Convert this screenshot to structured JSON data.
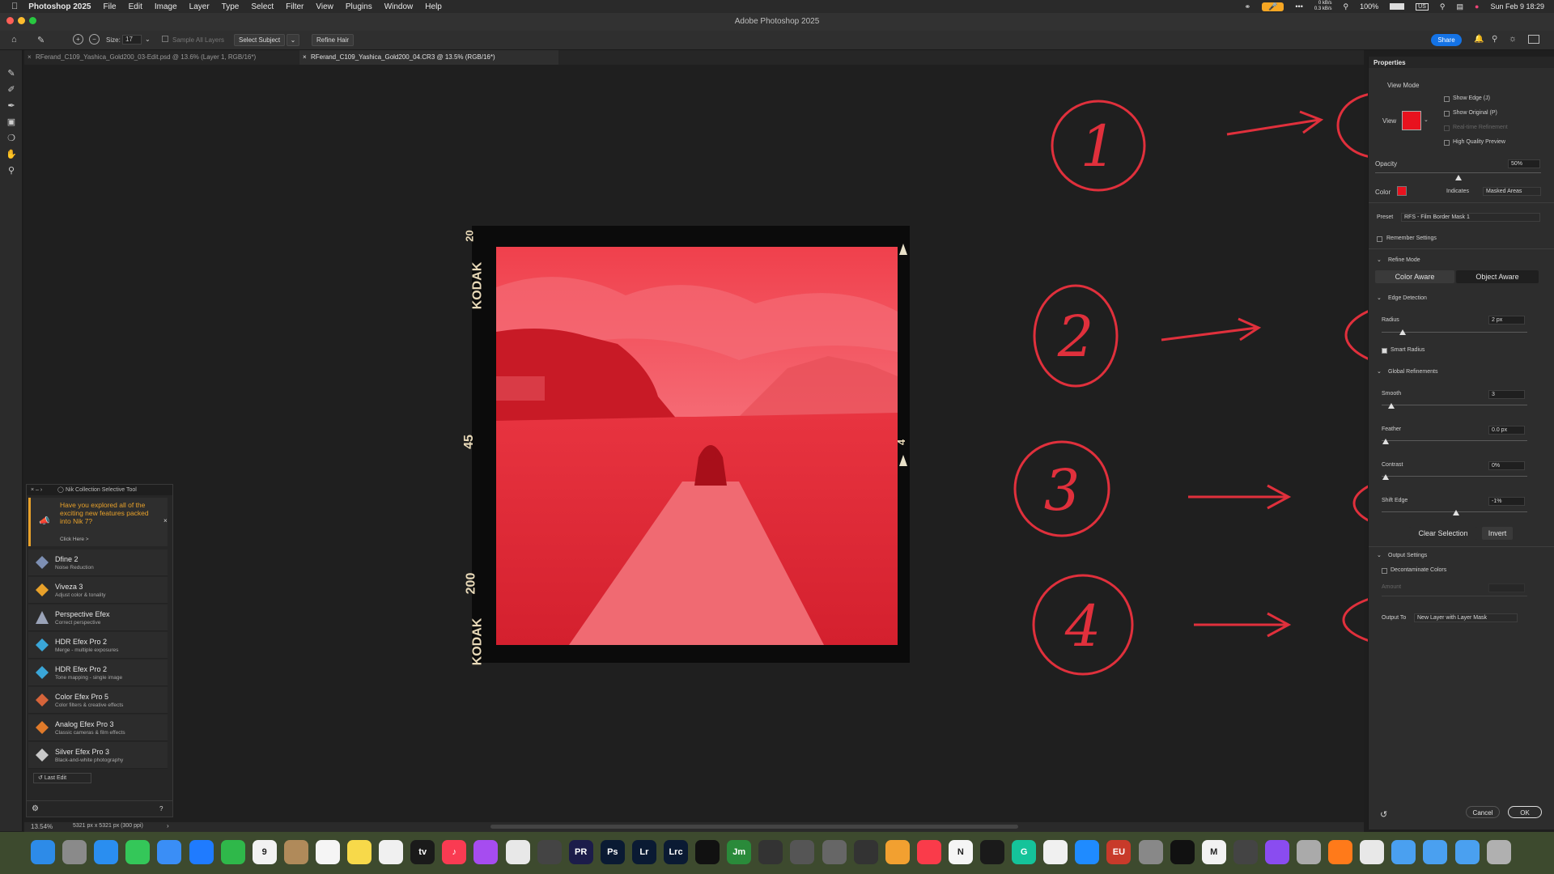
{
  "menubar": {
    "app_name": "Photoshop 2025",
    "items": [
      "File",
      "Edit",
      "Image",
      "Layer",
      "Type",
      "Select",
      "Filter",
      "View",
      "Plugins",
      "Window",
      "Help"
    ],
    "net_up": "0 kB/s",
    "net_down": "0.3 kB/s",
    "battery": "100%",
    "input_source": "US",
    "datetime": "Sun Feb 9  18:29"
  },
  "window": {
    "title": "Adobe Photoshop 2025"
  },
  "options_bar": {
    "size_label": "Size:",
    "size_value": "17",
    "sample_all_layers": "Sample All Layers",
    "select_subject": "Select Subject",
    "refine_hair": "Refine Hair",
    "share": "Share"
  },
  "tabs": [
    {
      "label": "RFerand_C109_Yashica_Gold200_03-Edit.psd @ 13.6% (Layer 1, RGB/16*)"
    },
    {
      "label": "RFerand_C109_Yashica_Gold200_04.CR3 @ 13.5% (RGB/16*)"
    }
  ],
  "film_border": {
    "top_number": "20",
    "brand_top": "KODAK",
    "middle_number": "45",
    "bottom_number": "200",
    "brand_bottom": "KODAK",
    "right_number": "4"
  },
  "annotations": {
    "numbers": [
      "1",
      "2",
      "3",
      "4"
    ],
    "color": "#e0303c"
  },
  "properties": {
    "header": "Properties",
    "view_mode": "View Mode",
    "view": "View",
    "show_edge": "Show Edge (J)",
    "show_original": "Show Original (P)",
    "realtime_refinement": "Real-time Refinement",
    "high_quality_preview": "High Quality Preview",
    "opacity_label": "Opacity",
    "opacity_value": "50%",
    "opacity_level": 0.5,
    "color_label": "Color",
    "mask_color": "#e8121e",
    "indicates_label": "Indicates",
    "indicates_value": "Masked Areas",
    "preset_label": "Preset",
    "preset_value": "RFS - Film Border Mask 1",
    "remember_settings": "Remember Settings",
    "refine_mode": "Refine Mode",
    "color_aware": "Color Aware",
    "object_aware": "Object Aware",
    "edge_detection": "Edge Detection",
    "radius_label": "Radius",
    "radius_value": "2 px",
    "smart_radius": "Smart Radius",
    "global_refinements": "Global Refinements",
    "smooth_label": "Smooth",
    "smooth_value": "3",
    "feather_label": "Feather",
    "feather_value": "0.0 px",
    "contrast_label": "Contrast",
    "contrast_value": "0%",
    "shift_edge_label": "Shift Edge",
    "shift_edge_value": "-1%",
    "clear_selection": "Clear Selection",
    "invert": "Invert",
    "output_settings": "Output Settings",
    "decontaminate_colors": "Decontaminate Colors",
    "amount_label": "Amount",
    "output_to_label": "Output To",
    "output_to_value": "New Layer with Layer Mask",
    "cancel": "Cancel",
    "ok": "OK"
  },
  "nik": {
    "title": "Nik Collection Selective Tool",
    "promo": "Have you explored all of the exciting new features packed into Nik 7?",
    "promo_link": "Click Here >",
    "items": [
      {
        "name": "Dfine 2",
        "desc": "Noise Reduction",
        "color": "#7d8fb3"
      },
      {
        "name": "Viveza 3",
        "desc": "Adjust color & tonality",
        "color": "#e8a12a"
      },
      {
        "name": "Perspective Efex",
        "desc": "Correct perspective",
        "color": "#9aa3b8"
      },
      {
        "name": "HDR Efex Pro 2",
        "desc": "Merge - multiple exposures",
        "color": "#3aa6d8"
      },
      {
        "name": "HDR Efex Pro 2",
        "desc": "Tone mapping - single image",
        "color": "#3aa6d8"
      },
      {
        "name": "Color Efex Pro 5",
        "desc": "Color filters & creative effects",
        "color": "#d6643a"
      },
      {
        "name": "Analog Efex Pro 3",
        "desc": "Classic cameras & film effects",
        "color": "#e07a2a"
      },
      {
        "name": "Silver Efex Pro 3",
        "desc": "Black-and-white photography",
        "color": "#c8c8c8"
      }
    ],
    "last_edit": "Last Edit"
  },
  "status": {
    "zoom": "13.54%",
    "doc_info": "5321 px x 5321 px (300 ppi)"
  },
  "dock": {
    "items": [
      {
        "icon": "finder-icon",
        "color": "#2d8be8",
        "label": ""
      },
      {
        "icon": "launchpad-icon",
        "color": "#8a8a8a",
        "label": ""
      },
      {
        "icon": "safari-icon",
        "color": "#2a8ef0",
        "label": ""
      },
      {
        "icon": "messages-icon",
        "color": "#34c759",
        "label": ""
      },
      {
        "icon": "mail-icon",
        "color": "#3a8ef6",
        "label": ""
      },
      {
        "icon": "app-store-icon",
        "color": "#1f7bff",
        "label": ""
      },
      {
        "icon": "facetime-icon",
        "color": "#2fb84a",
        "label": ""
      },
      {
        "icon": "calendar-icon",
        "color": "#f2f2f2",
        "label": "9"
      },
      {
        "icon": "contacts-icon",
        "color": "#b08a5a",
        "label": ""
      },
      {
        "icon": "reminders-icon",
        "color": "#f5f5f5",
        "label": ""
      },
      {
        "icon": "notes-icon",
        "color": "#f7d94a",
        "label": ""
      },
      {
        "icon": "freeform-icon",
        "color": "#f0f0f0",
        "label": ""
      },
      {
        "icon": "tv-icon",
        "color": "#1a1a1a",
        "label": "tv"
      },
      {
        "icon": "music-icon",
        "color": "#fa3b52",
        "label": "♪"
      },
      {
        "icon": "podcasts-icon",
        "color": "#a64cf0",
        "label": ""
      },
      {
        "icon": "photos-icon",
        "color": "#e8e8e8",
        "label": ""
      },
      {
        "icon": "photo-booth-icon",
        "color": "#444444",
        "label": ""
      },
      {
        "icon": "premiere-icon",
        "color": "#1c1c4a",
        "label": "PR"
      },
      {
        "icon": "photoshop-icon",
        "color": "#0a1a33",
        "label": "Ps"
      },
      {
        "icon": "lightroom-icon",
        "color": "#0a1a33",
        "label": "Lr"
      },
      {
        "icon": "lightroom-classic-icon",
        "color": "#0a1a33",
        "label": "Lrc"
      },
      {
        "icon": "affinity-icon",
        "color": "#111111",
        "label": ""
      },
      {
        "icon": "jm-icon",
        "color": "#2a8a3a",
        "label": "Jm"
      },
      {
        "icon": "final-cut-icon",
        "color": "#333333",
        "label": ""
      },
      {
        "icon": "color-finale-icon",
        "color": "#555555",
        "label": ""
      },
      {
        "icon": "compressor-icon",
        "color": "#666666",
        "label": ""
      },
      {
        "icon": "davinci-icon",
        "color": "#333333",
        "label": ""
      },
      {
        "icon": "pages-icon",
        "color": "#f2a030",
        "label": ""
      },
      {
        "icon": "news-icon",
        "color": "#fa3b4a",
        "label": ""
      },
      {
        "icon": "notion-icon",
        "color": "#f5f5f5",
        "label": "N"
      },
      {
        "icon": "butterfly-icon",
        "color": "#1a1a1a",
        "label": ""
      },
      {
        "icon": "grammarly-icon",
        "color": "#15c39a",
        "label": "G"
      },
      {
        "icon": "perplexity-icon",
        "color": "#f0f0f0",
        "label": ""
      },
      {
        "icon": "app-store-2-icon",
        "color": "#1f8bff",
        "label": ""
      },
      {
        "icon": "eu-icon",
        "color": "#c83a2a",
        "label": "EU"
      },
      {
        "icon": "system-settings-icon",
        "color": "#888888",
        "label": ""
      },
      {
        "icon": "chatgpt-icon",
        "color": "#111111",
        "label": ""
      },
      {
        "icon": "gmail-icon",
        "color": "#f2f2f2",
        "label": "M"
      },
      {
        "icon": "audio-icon",
        "color": "#444444",
        "label": ""
      },
      {
        "icon": "messenger-icon",
        "color": "#8a4cf0",
        "label": ""
      },
      {
        "icon": "trash-bin-icon",
        "color": "#aaaaaa",
        "label": ""
      },
      {
        "icon": "firefox-icon",
        "color": "#ff7a1a",
        "label": ""
      },
      {
        "icon": "chart-app-icon",
        "color": "#e8e8e8",
        "label": ""
      },
      {
        "icon": "folder-icon",
        "color": "#4aa0f0",
        "label": ""
      },
      {
        "icon": "applications-folder-icon",
        "color": "#4aa0f0",
        "label": ""
      },
      {
        "icon": "downloads-folder-icon",
        "color": "#4aa0f0",
        "label": ""
      },
      {
        "icon": "trash-icon",
        "color": "#b0b0b0",
        "label": ""
      }
    ]
  }
}
